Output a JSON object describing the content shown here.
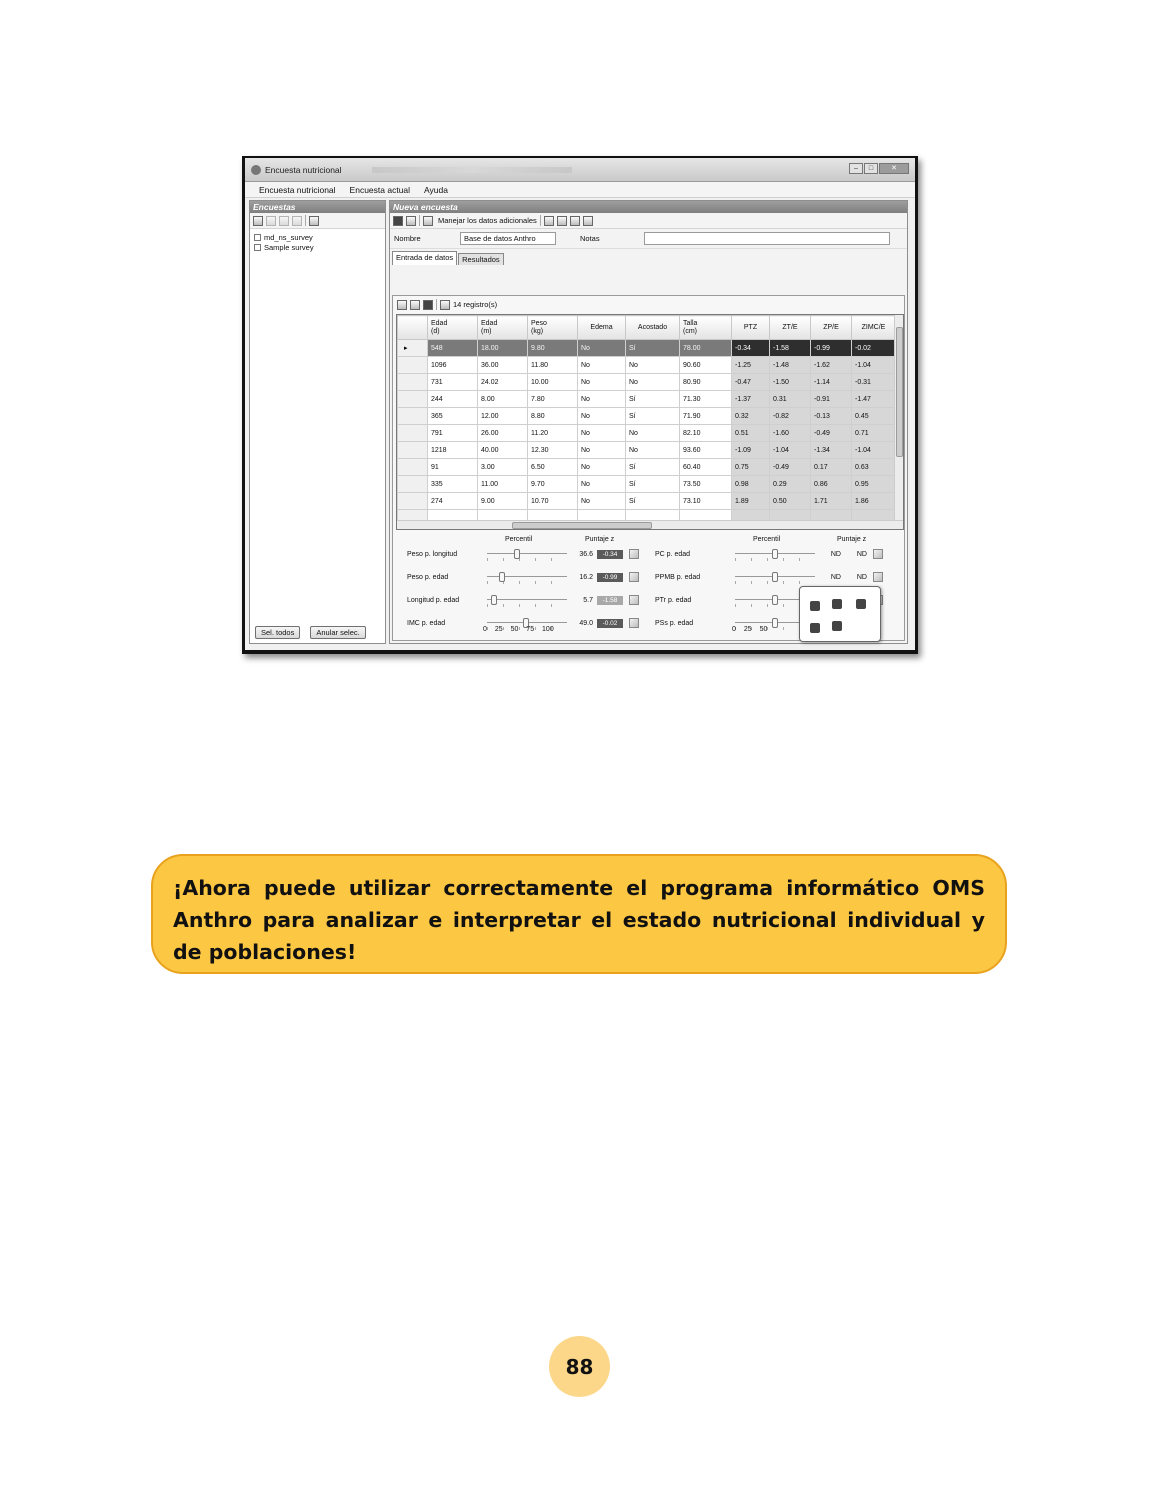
{
  "window": {
    "title": "Encuesta nutricional",
    "menu": [
      "Encuesta nutricional",
      "Encuesta actual",
      "Ayuda"
    ]
  },
  "left_pane": {
    "header": "Encuestas",
    "surveys": [
      "md_ns_survey",
      "Sample survey"
    ],
    "select_all_label": "Sel. todos",
    "deselect_label": "Anular selec."
  },
  "right_pane": {
    "header": "Nueva encuesta",
    "manage_label": "Manejar los datos adicionales",
    "name_label": "Nombre",
    "name_value": "Base de datos Anthro",
    "notes_label": "Notas",
    "notes_value": "",
    "tabs": [
      "Entrada de datos",
      "Resultados"
    ],
    "records_label": "14 registro(s)"
  },
  "grid": {
    "columns": [
      {
        "l1": "Edad",
        "l2": "(d)"
      },
      {
        "l1": "Edad",
        "l2": "(m)"
      },
      {
        "l1": "Peso",
        "l2": "(kg)"
      },
      {
        "l1": "Edema",
        "l2": ""
      },
      {
        "l1": "Acostado",
        "l2": ""
      },
      {
        "l1": "Talla",
        "l2": "(cm)"
      },
      {
        "l1": "PTZ",
        "l2": ""
      },
      {
        "l1": "ZT/E",
        "l2": ""
      },
      {
        "l1": "ZP/E",
        "l2": ""
      },
      {
        "l1": "ZIMC/E",
        "l2": ""
      }
    ],
    "rows": [
      [
        "548",
        "18.00",
        "9.80",
        "No",
        "Sí",
        "78.00",
        "-0.34",
        "-1.58",
        "-0.99",
        "-0.02"
      ],
      [
        "1096",
        "36.00",
        "11.80",
        "No",
        "No",
        "90.60",
        "-1.25",
        "-1.48",
        "-1.62",
        "-1.04"
      ],
      [
        "731",
        "24.02",
        "10.00",
        "No",
        "No",
        "80.90",
        "-0.47",
        "-1.50",
        "-1.14",
        "-0.31"
      ],
      [
        "244",
        "8.00",
        "7.80",
        "No",
        "Sí",
        "71.30",
        "-1.37",
        "0.31",
        "-0.91",
        "-1.47"
      ],
      [
        "365",
        "12.00",
        "8.80",
        "No",
        "Sí",
        "71.90",
        "0.32",
        "-0.82",
        "-0.13",
        "0.45"
      ],
      [
        "791",
        "26.00",
        "11.20",
        "No",
        "No",
        "82.10",
        "0.51",
        "-1.60",
        "-0.49",
        "0.71"
      ],
      [
        "1218",
        "40.00",
        "12.30",
        "No",
        "No",
        "93.60",
        "-1.09",
        "-1.04",
        "-1.34",
        "-1.04"
      ],
      [
        "91",
        "3.00",
        "6.50",
        "No",
        "Sí",
        "60.40",
        "0.75",
        "-0.49",
        "0.17",
        "0.63"
      ],
      [
        "335",
        "11.00",
        "9.70",
        "No",
        "Sí",
        "73.50",
        "0.98",
        "0.29",
        "0.86",
        "0.95"
      ],
      [
        "274",
        "9.00",
        "10.70",
        "No",
        "Sí",
        "73.10",
        "1.89",
        "0.50",
        "1.71",
        "1.86"
      ]
    ]
  },
  "indicators": {
    "percentile_header": "Percentil",
    "z_header": "Puntaje z",
    "axis": "0 25 50 75 100",
    "axis_partial": "0 25 50",
    "left": [
      {
        "label": "Peso p. longitud",
        "percentile": "36.6",
        "z": "-0.34",
        "pct_value": 36.6
      },
      {
        "label": "Peso p. edad",
        "percentile": "16.2",
        "z": "-0.99",
        "pct_value": 16.2
      },
      {
        "label": "Longitud p. edad",
        "percentile": "5.7",
        "z": "-1.58",
        "pct_value": 5.7
      },
      {
        "label": "IMC p. edad",
        "percentile": "49.0",
        "z": "-0.02",
        "pct_value": 49.0
      }
    ],
    "right": [
      {
        "label": "PC p. edad",
        "percentile": "ND",
        "z": "ND"
      },
      {
        "label": "PPMB p. edad",
        "percentile": "ND",
        "z": "ND"
      },
      {
        "label": "PTr p. edad",
        "percentile": "ND",
        "z": "ND"
      },
      {
        "label": "PSs p. edad",
        "percentile": "",
        "z": ""
      }
    ]
  },
  "callout": {
    "text": "¡Ahora puede utilizar correctamente el programa informático OMS Anthro para analizar e interpretar el estado nutricional individual y de poblaciones!"
  },
  "page_number": "88",
  "colors": {
    "callout_fill": "#fcc742",
    "callout_border": "#e8a21e",
    "page_number_fill": "#fcd78a"
  }
}
